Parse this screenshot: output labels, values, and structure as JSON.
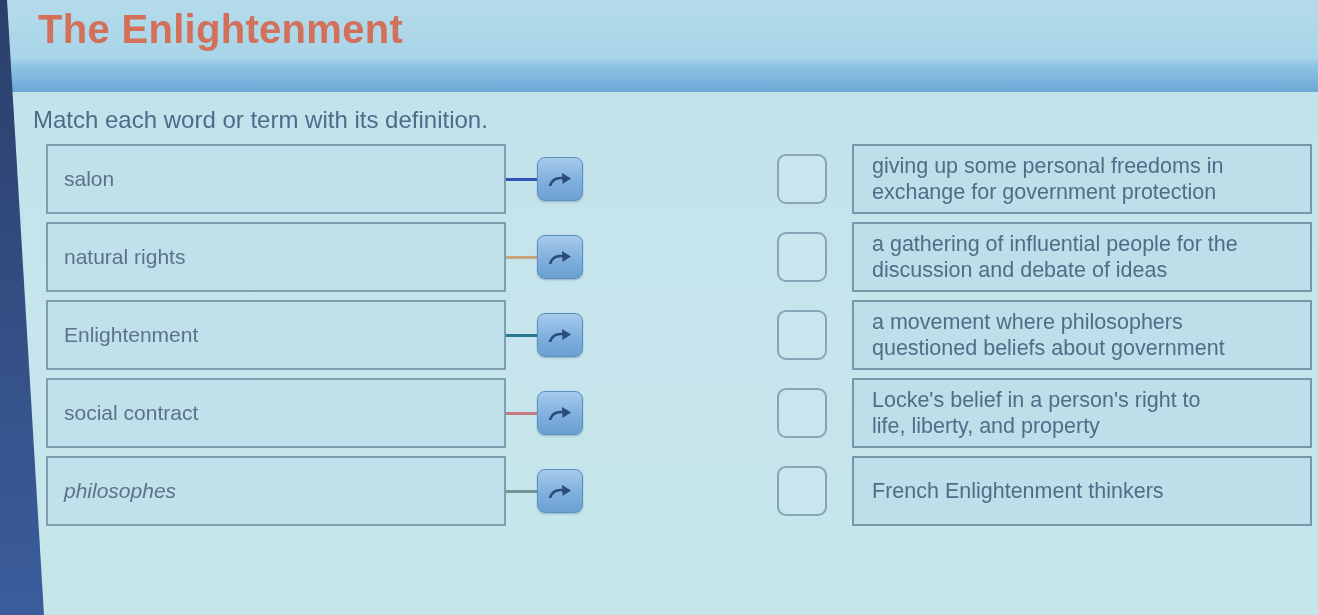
{
  "header": {
    "title": "The Enlightenment"
  },
  "instruction": "Match each word or term with its definition.",
  "terms": [
    {
      "text": "salon",
      "italic": false,
      "color": "#2f56b4"
    },
    {
      "text": "natural rights",
      "italic": false,
      "color": "#c9a27e"
    },
    {
      "text": "Enlightenment",
      "italic": false,
      "color": "#2a7893"
    },
    {
      "text": "social contract",
      "italic": false,
      "color": "#c97a80"
    },
    {
      "text": "philosophes",
      "italic": true,
      "color": "#6f9596"
    }
  ],
  "definitions": [
    {
      "text": "giving up some personal freedoms in exchange for government protection"
    },
    {
      "text": "a gathering of influential people for the discussion and debate of ideas"
    },
    {
      "text": "a movement where philosophers questioned beliefs about government"
    },
    {
      "text": "Locke's belief in a person's right to life, liberty, and property"
    },
    {
      "text": "French Enlightenment thinkers"
    }
  ]
}
